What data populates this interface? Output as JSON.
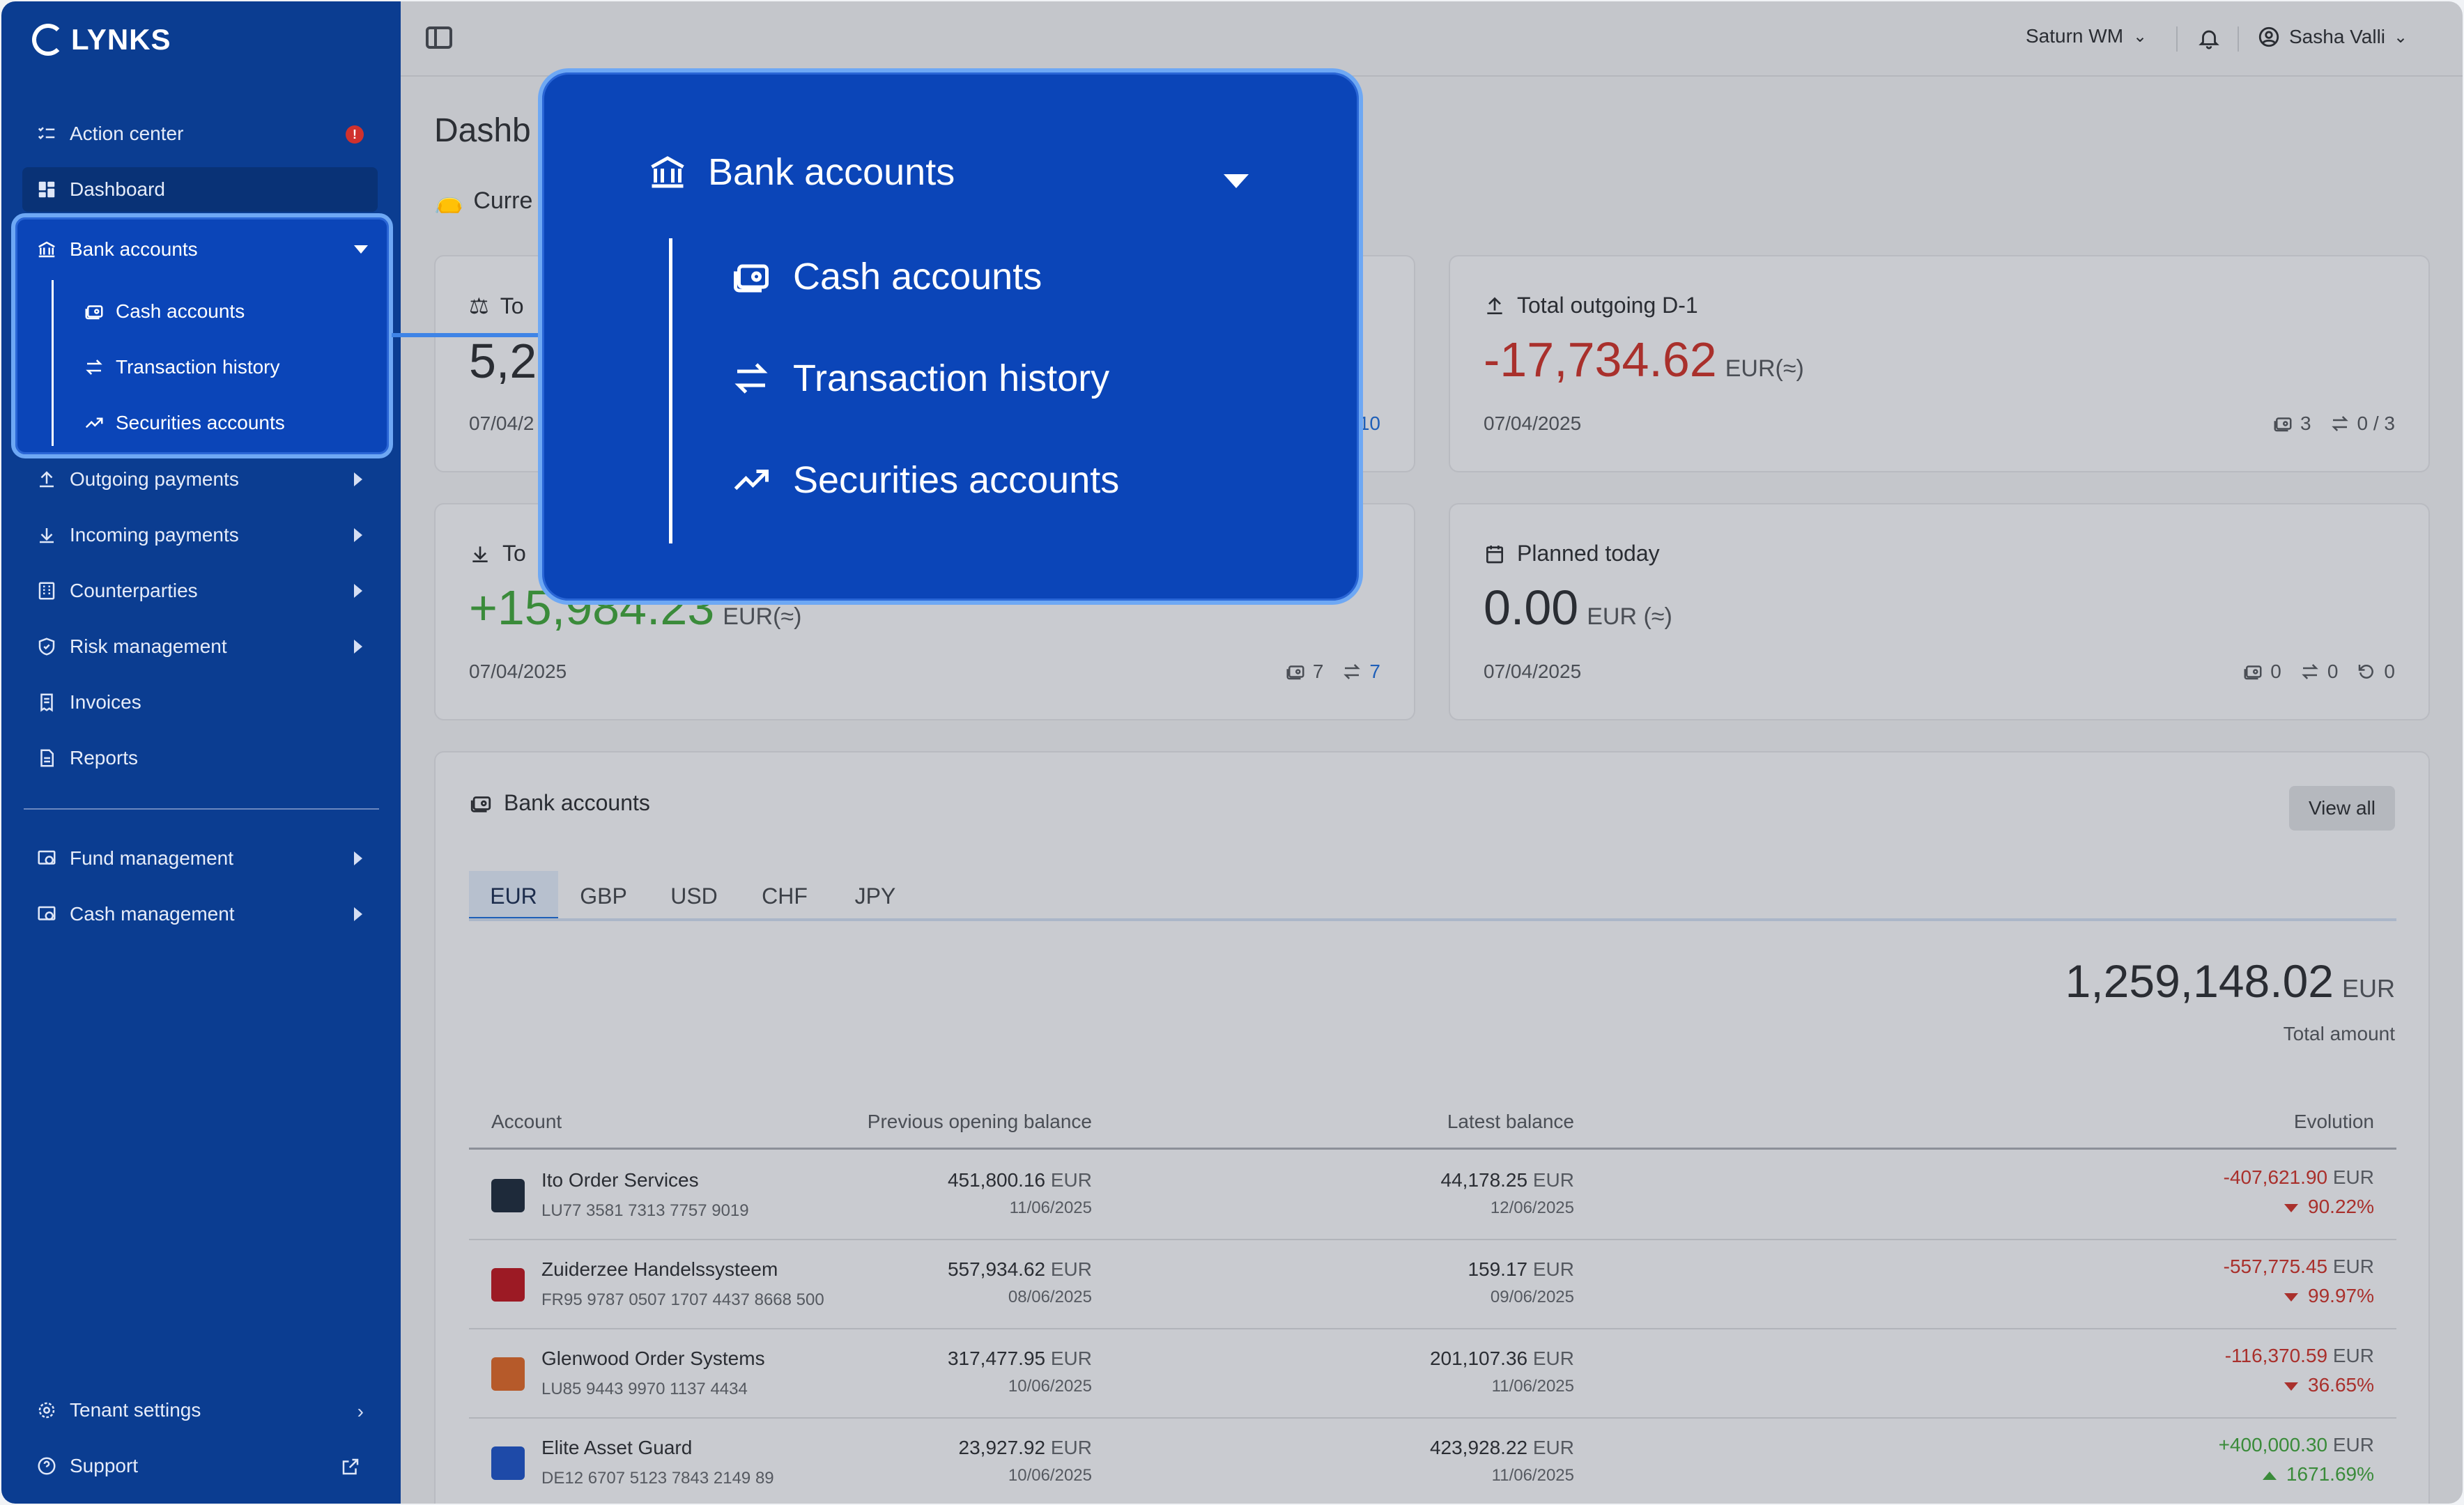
{
  "brand": {
    "name": "LYNKS"
  },
  "sidebar": {
    "items": [
      {
        "label": "Action center"
      },
      {
        "label": "Dashboard"
      },
      {
        "label": "Bank accounts"
      },
      {
        "label": "Outgoing payments"
      },
      {
        "label": "Incoming payments"
      },
      {
        "label": "Counterparties"
      },
      {
        "label": "Risk management"
      },
      {
        "label": "Invoices"
      },
      {
        "label": "Reports"
      },
      {
        "label": "Fund management"
      },
      {
        "label": "Cash management"
      },
      {
        "label": "Tenant settings"
      },
      {
        "label": "Support"
      }
    ],
    "action_badge": "!",
    "bank_sub": [
      {
        "label": "Cash accounts"
      },
      {
        "label": "Transaction history"
      },
      {
        "label": "Securities accounts"
      }
    ]
  },
  "topbar": {
    "tenant": "Saturn WM",
    "user": "Sasha Valli"
  },
  "page": {
    "title": "Dashb",
    "current_label": "Curre"
  },
  "cards": {
    "total_balance": {
      "title": "To",
      "amount": "5,2",
      "date": "07/04/2",
      "link_count": "10"
    },
    "total_outgoing": {
      "title": "Total outgoing D-1",
      "amount": "-17,734.62",
      "unit": "EUR(≈)",
      "date": "07/04/2025",
      "accounts": "3",
      "tx": "0 / 3"
    },
    "total_incoming": {
      "title": "To",
      "amount": "+15,984.23",
      "unit": "EUR(≈)",
      "date": "07/04/2025",
      "accounts": "7",
      "tx": "7"
    },
    "planned_today": {
      "title": "Planned today",
      "amount": "0.00",
      "unit": "EUR (≈)",
      "date": "07/04/2025",
      "accounts": "0",
      "tx": "0",
      "recurring": "0"
    }
  },
  "bank_section": {
    "title": "Bank accounts",
    "view_all": "View all",
    "tabs": [
      "EUR",
      "GBP",
      "USD",
      "CHF",
      "JPY"
    ],
    "total": "1,259,148.02",
    "total_unit": "EUR",
    "total_label": "Total amount",
    "columns": [
      "Account",
      "Previous opening balance",
      "Latest balance",
      "Evolution"
    ],
    "rows": [
      {
        "name": "Ito Order Services",
        "iban": "LU77 3581 7313 7757 9019",
        "prev": "451,800.16",
        "prev_date": "11/06/2025",
        "latest": "44,178.25",
        "latest_date": "12/06/2025",
        "evo": "-407,621.90",
        "pct": "90.22%",
        "dir": "down",
        "logo_color": "#1e2a3a"
      },
      {
        "name": "Zuiderzee Handelssysteem",
        "iban": "FR95 9787 0507 1707 4437 8668 500",
        "prev": "557,934.62",
        "prev_date": "08/06/2025",
        "latest": "159.17",
        "latest_date": "09/06/2025",
        "evo": "-557,775.45",
        "pct": "99.97%",
        "dir": "down",
        "logo_color": "#9c1a24"
      },
      {
        "name": "Glenwood Order Systems",
        "iban": "LU85 9443 9970 1137 4434",
        "prev": "317,477.95",
        "prev_date": "10/06/2025",
        "latest": "201,107.36",
        "latest_date": "11/06/2025",
        "evo": "-116,370.59",
        "pct": "36.65%",
        "dir": "down",
        "logo_color": "#b65a2a"
      },
      {
        "name": "Elite Asset Guard",
        "iban": "DE12 6707 5123 7843 2149 89",
        "prev": "23,927.92",
        "prev_date": "10/06/2025",
        "latest": "423,928.22",
        "latest_date": "11/06/2025",
        "evo": "+400,000.30",
        "pct": "1671.69%",
        "dir": "up",
        "logo_color": "#1e4aa8"
      }
    ],
    "unit": "EUR"
  },
  "zoom": {
    "title": "Bank accounts",
    "items": [
      "Cash accounts",
      "Transaction history",
      "Securities accounts"
    ]
  }
}
